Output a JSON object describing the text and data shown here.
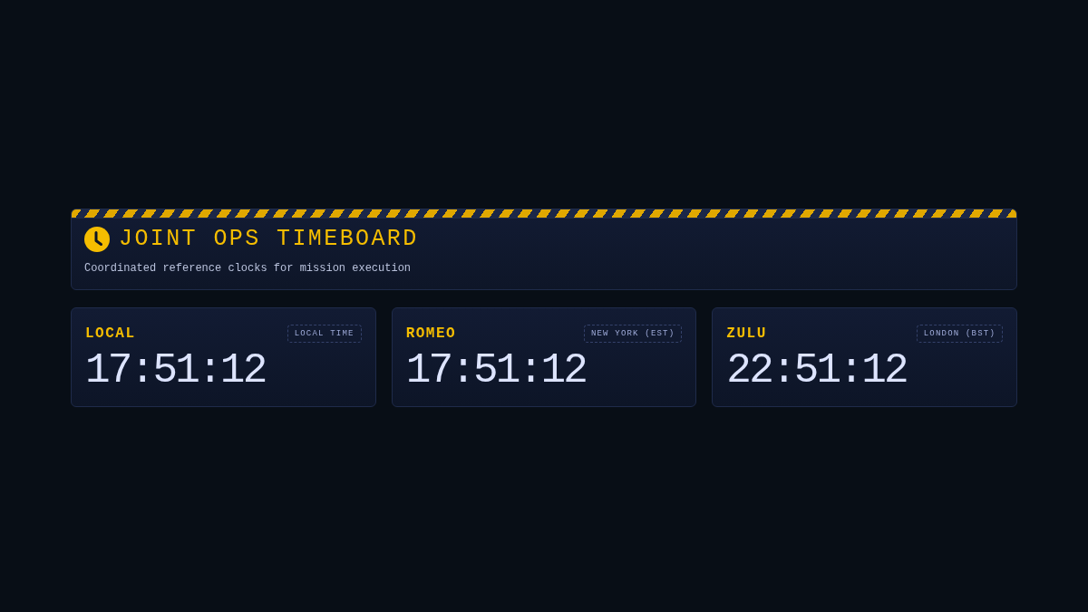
{
  "header": {
    "title": "JOINT OPS TIMEBOARD",
    "subtitle": "Coordinated reference clocks for mission execution"
  },
  "clocks": [
    {
      "callsign": "LOCAL",
      "zone": "LOCAL TIME",
      "time": "17:51:12"
    },
    {
      "callsign": "ROMEO",
      "zone": "NEW YORK (EST)",
      "time": "17:51:12"
    },
    {
      "callsign": "ZULU",
      "zone": "LONDON (BST)",
      "time": "22:51:12"
    }
  ]
}
